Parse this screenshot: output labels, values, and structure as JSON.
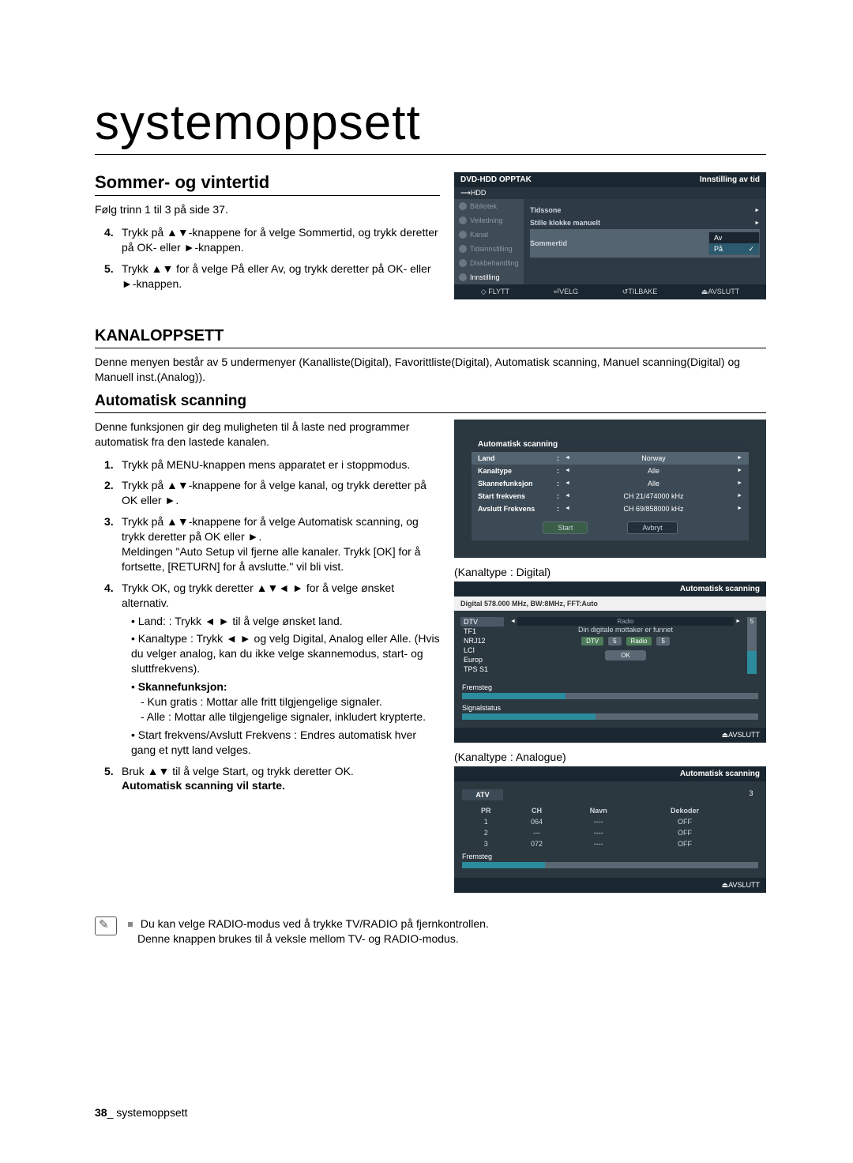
{
  "mainTitle": "systemoppsett",
  "sommer": {
    "heading": "Sommer- og vintertid",
    "intro": "Følg trinn 1 til 3 på side 37.",
    "step4": "Trykk på ▲▼-knappene for å velge Sommertid, og trykk deretter på OK- eller ►-knappen.",
    "step5": "Trykk ▲▼ for å velge På eller Av, og trykk deretter på OK- eller ►-knappen."
  },
  "osd": {
    "titleLeft": "DVD-HDD OPPTAK",
    "titleRight": "Innstilling av tid",
    "hdd": "⟶HDD",
    "side": {
      "bibliotek": "Bibliotek",
      "veiledning": "Veiledning",
      "kanal": "Kanal",
      "tidsinnstilling": "Tidsinnstilling",
      "diskbehandling": "Diskbehandling",
      "innstilling": "Innstilling"
    },
    "rows": {
      "tidssone": "Tidssone",
      "stille": "Stille klokke manuelt",
      "sommertid": "Sommertid"
    },
    "options": {
      "av": "Av",
      "pa": "På"
    },
    "footer": {
      "flytt": "◇ FLYTT",
      "velg": "⏎VELG",
      "tilbake": "↺TILBAKE",
      "avslutt": "⏏AVSLUTT"
    }
  },
  "kanal": {
    "heading": "KANALOPPSETT",
    "intro": "Denne menyen består av 5 undermenyer (Kanalliste(Digital), Favorittliste(Digital), Automatisk scanning, Manuel scanning(Digital) og Manuell inst.(Analog))."
  },
  "auto": {
    "heading": "Automatisk scanning",
    "intro": "Denne funksjonen gir deg muligheten til å laste ned programmer automatisk fra den lastede kanalen.",
    "s1": "Trykk på MENU-knappen mens apparatet er i stoppmodus.",
    "s2": "Trykk på ▲▼-knappene for å velge kanal, og trykk deretter på OK eller ►.",
    "s3a": "Trykk på ▲▼-knappene for å velge Automatisk scanning, og trykk deretter på OK eller ►.",
    "s3b": "Meldingen \"Auto Setup vil fjerne alle kanaler. Trykk [OK] for å fortsette, [RETURN] for å avslutte.\" vil bli vist.",
    "s4": "Trykk OK, og trykk deretter ▲▼◄ ► for å velge ønsket alternativ.",
    "land": "Land: : Trykk ◄ ► til å velge ønsket land.",
    "kanaltype": "Kanaltype : Trykk ◄ ► og velg Digital, Analog eller Alle. (Hvis du velger analog, kan du ikke velge skannemodus, start- og sluttfrekvens).",
    "skanne": "Skannefunksjon:",
    "skanne_a": "- Kun gratis : Mottar alle fritt tilgjengelige signaler.",
    "skanne_b": "- Alle : Mottar alle tilgjengelige signaler, inkludert krypterte.",
    "startfrek": "Start frekvens/Avslutt Frekvens : Endres automatisk hver gang et nytt land velges.",
    "s5a": "Bruk ▲▼ til å velge Start, og trykk deretter OK.",
    "s5b": "Automatisk scanning vil starte."
  },
  "scanbox": {
    "title": "Automatisk scanning",
    "land": {
      "k": "Land",
      "v": "Norway"
    },
    "kanaltype": {
      "k": "Kanaltype",
      "v": "Alle"
    },
    "skannef": {
      "k": "Skannefunksjon",
      "v": "Alle"
    },
    "start": {
      "k": "Start frekvens",
      "v": "CH 21/474000 kHz"
    },
    "slutt": {
      "k": "Avslutt Frekvens",
      "v": "CH 69/858000 kHz"
    },
    "btnStart": "Start",
    "btnAvbryt": "Avbryt"
  },
  "captionDigital": "(Kanaltype : Digital)",
  "prog": {
    "title": "Automatisk scanning",
    "sub": "Digital 578.000 MHz, BW:8MHz, FFT:Auto",
    "dtv": "DTV",
    "channels": [
      "TF1",
      "NRJ12",
      "LCI",
      "Europ",
      "TPS S1"
    ],
    "found": "Din digitale mottaker er funnet",
    "chip_dtv": "DTV",
    "chip_dtv_n": "5",
    "chip_radio": "Radio",
    "chip_radio_n": "5",
    "ok": "OK",
    "count": "5",
    "fremsteg": "Fremsteg",
    "signal": "Signalstatus",
    "avslutt": "⏏AVSLUTT"
  },
  "captionAnalogue": "(Kanaltype : Analogue)",
  "apanel": {
    "title": "Automatisk scanning",
    "atv": "ATV",
    "count": "3",
    "head": {
      "pr": "PR",
      "ch": "CH",
      "navn": "Navn",
      "dekoder": "Dekoder"
    },
    "rows": [
      {
        "pr": "1",
        "ch": "064",
        "navn": "----",
        "dek": "OFF"
      },
      {
        "pr": "2",
        "ch": "---",
        "navn": "----",
        "dek": "OFF"
      },
      {
        "pr": "3",
        "ch": "072",
        "navn": "----",
        "dek": "OFF"
      }
    ],
    "fremsteg": "Fremsteg",
    "avslutt": "⏏AVSLUTT"
  },
  "note": {
    "line1": "Du kan velge RADIO-modus ved å trykke TV/RADIO på fjernkontrollen.",
    "line2": "Denne knappen brukes til å veksle mellom TV- og RADIO-modus."
  },
  "footer": {
    "pageNum": "38",
    "sep": "_ ",
    "label": "systemoppsett"
  }
}
